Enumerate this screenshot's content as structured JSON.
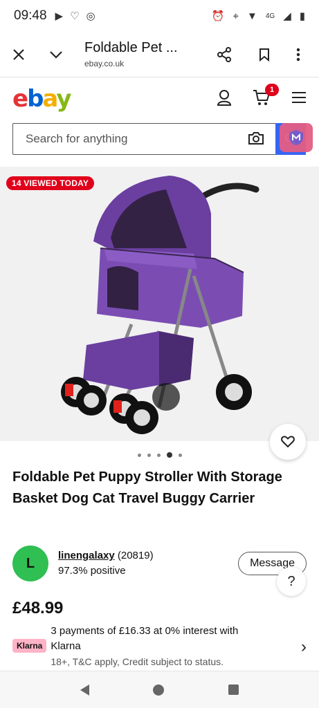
{
  "status": {
    "time": "09:48",
    "network": "4G"
  },
  "browser": {
    "title": "Foldable Pet ...",
    "url": "ebay.co.uk"
  },
  "header": {
    "cart_count": "1"
  },
  "search": {
    "placeholder": "Search for anything"
  },
  "listing": {
    "viewed_badge": "14 VIEWED TODAY",
    "image_count": 5,
    "active_image": 4,
    "title": "Foldable Pet Puppy Stroller With Storage Basket Dog Cat Travel Buggy Carrier",
    "price": "£48.99"
  },
  "seller": {
    "initial": "L",
    "name": "linengalaxy",
    "feedback": "(20819)",
    "positive": "97.3% positive",
    "message_label": "Message"
  },
  "help": {
    "label": "?"
  },
  "klarna": {
    "badge": "Klarna",
    "line1": "3 payments of £16.33 at 0% interest with Klarna",
    "line2": "18+, T&C apply, Credit subject to status."
  },
  "colors": {
    "brand_blue": "#3665f3",
    "badge_red": "#e0001b",
    "stroller_purple": "#6a3fa0"
  }
}
